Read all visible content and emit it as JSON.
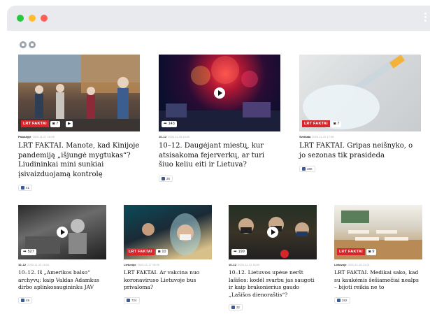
{
  "browser": {
    "traffic_lights": [
      "#28c940",
      "#ffbd2e",
      "#ff5f57"
    ],
    "bar_color": "#e8eaee"
  },
  "colors": {
    "lrt_red": "#d7262b",
    "facebook_blue": "#3b5998"
  },
  "top_cards": [
    {
      "tag": "LRT FAKTAI",
      "photo_count": "7",
      "category": "Pasaulyje",
      "date": "2020-11-27 16:08",
      "title": "LRT FAKTAI. Manote, kad Kinijoje pandemiją „išjungė mygtukas“? Liudininkai mini sunkiai įsivaizduojamą kontrolę",
      "likes": "41",
      "image": "covid-street-photo"
    },
    {
      "tag": "",
      "video_views": "143",
      "category": "10–12",
      "date": "2020-11-28 16:00",
      "title": "10–12. Daugėjant miestų, kur atsisakoma fejerverkų, ar turi šiuo keliu eiti ir Lietuva?",
      "likes": "26",
      "image": "fireworks-photo"
    },
    {
      "tag": "LRT FAKTAI",
      "photo_count": "7",
      "category": "Sveikata",
      "date": "2020-11-22 17:08",
      "title": "LRT FAKTAI. Gripas neišnyko, o jo sezonas tik prasideda",
      "likes": "386",
      "image": "vaccine-syringe-photo"
    }
  ],
  "bottom_cards": [
    {
      "tag": "",
      "video_views": "527",
      "category": "10–12",
      "date": "2020-11-19 16:00",
      "title": "10–12. Iš „Amerikos balso“ archyvų: kaip Valdas Adamkus dirbo aplinkosaugininku JAV",
      "likes": "49",
      "image": "archive-bw-photo"
    },
    {
      "tag": "LRT FAKTAI",
      "photo_count": "10",
      "category": "Lietuvoje",
      "date": "2020-11-17 16:06",
      "title": "LRT FAKTAI. Ar vakcina nuo koronaviruso Lietuvoje bus privaloma?",
      "likes": "724",
      "image": "face-shield-photo"
    },
    {
      "tag": "",
      "video_views": "199",
      "category": "10–12",
      "date": "2020-11-12 16:00",
      "title": "10–12. Lietuvos upėse neršt lašišos: kodėl svarbu jas saugoti ir kaip brakonierius gaudo „Lašišos dienoraštis“?",
      "likes": "32",
      "image": "masked-people-photo"
    },
    {
      "tag": "LRT FAKTAI",
      "photo_count": "9",
      "category": "Lietuvoje",
      "date": "2020-11-30 21:01",
      "title": "LRT FAKTAI. Medikai sako, kad su kaukėmis šešiamečiai nealps – bijoti reikia ne to",
      "likes": "282",
      "image": "classroom-photo"
    }
  ]
}
